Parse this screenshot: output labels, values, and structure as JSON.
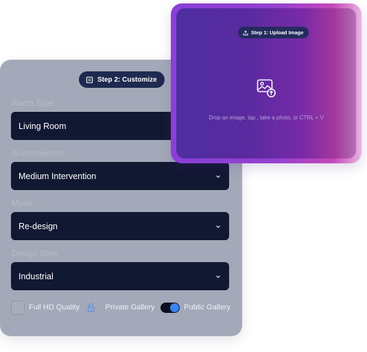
{
  "step2": {
    "pill_label": "Step 2: Customize",
    "fields": [
      {
        "label": "Room Type",
        "value": "Living Room"
      },
      {
        "label": "AI Intervention",
        "value": "Medium Intervention"
      },
      {
        "label": "Mode",
        "value": "Re-design"
      },
      {
        "label": "Design Style",
        "value": "Industrial"
      }
    ],
    "options": {
      "full_hd_label": "Full HD Quality",
      "full_hd_checked": false,
      "private_gallery_label": "Private Gallery",
      "public_gallery_label": "Public Gallery",
      "gallery_toggle": "public"
    }
  },
  "step1": {
    "pill_label": "Step 1: Upload Image",
    "hint": "Drop an image, tap , take a photo, or CTRL + V"
  },
  "colors": {
    "accent": "#3b82f6",
    "select_bg": "#111832",
    "card_bg": "#a3a9b8"
  }
}
